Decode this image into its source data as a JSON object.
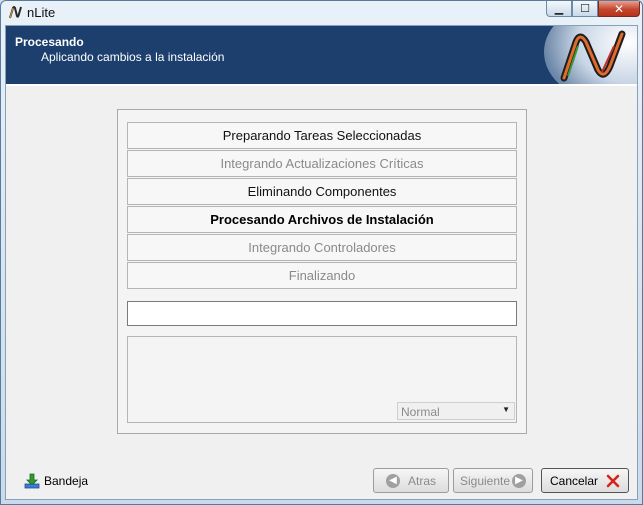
{
  "window": {
    "title": "nLite"
  },
  "header": {
    "title": "Procesando",
    "subtitle": "Aplicando cambios a la instalación"
  },
  "steps": [
    {
      "label": "Preparando Tareas Seleccionadas",
      "state": "done"
    },
    {
      "label": "Integrando Actualizaciones Críticas",
      "state": "pending"
    },
    {
      "label": "Eliminando Componentes",
      "state": "done"
    },
    {
      "label": "Procesando Archivos de Instalación",
      "state": "active"
    },
    {
      "label": "Integrando Controladores",
      "state": "pending"
    },
    {
      "label": "Finalizando",
      "state": "pending"
    }
  ],
  "progress": {
    "value": 0
  },
  "priority": {
    "selected": "Normal"
  },
  "footer": {
    "tray_label": "Bandeja",
    "back_label": "Atras",
    "next_label": "Siguiente",
    "cancel_label": "Cancelar"
  },
  "colors": {
    "header_bg": "#1c3f6e",
    "close_red": "#c4472f"
  },
  "icons": {
    "app": "nlite-logo-icon",
    "tray": "tray-download-icon",
    "back": "back-arrow-icon",
    "next": "next-arrow-icon",
    "cancel": "red-x-icon"
  }
}
